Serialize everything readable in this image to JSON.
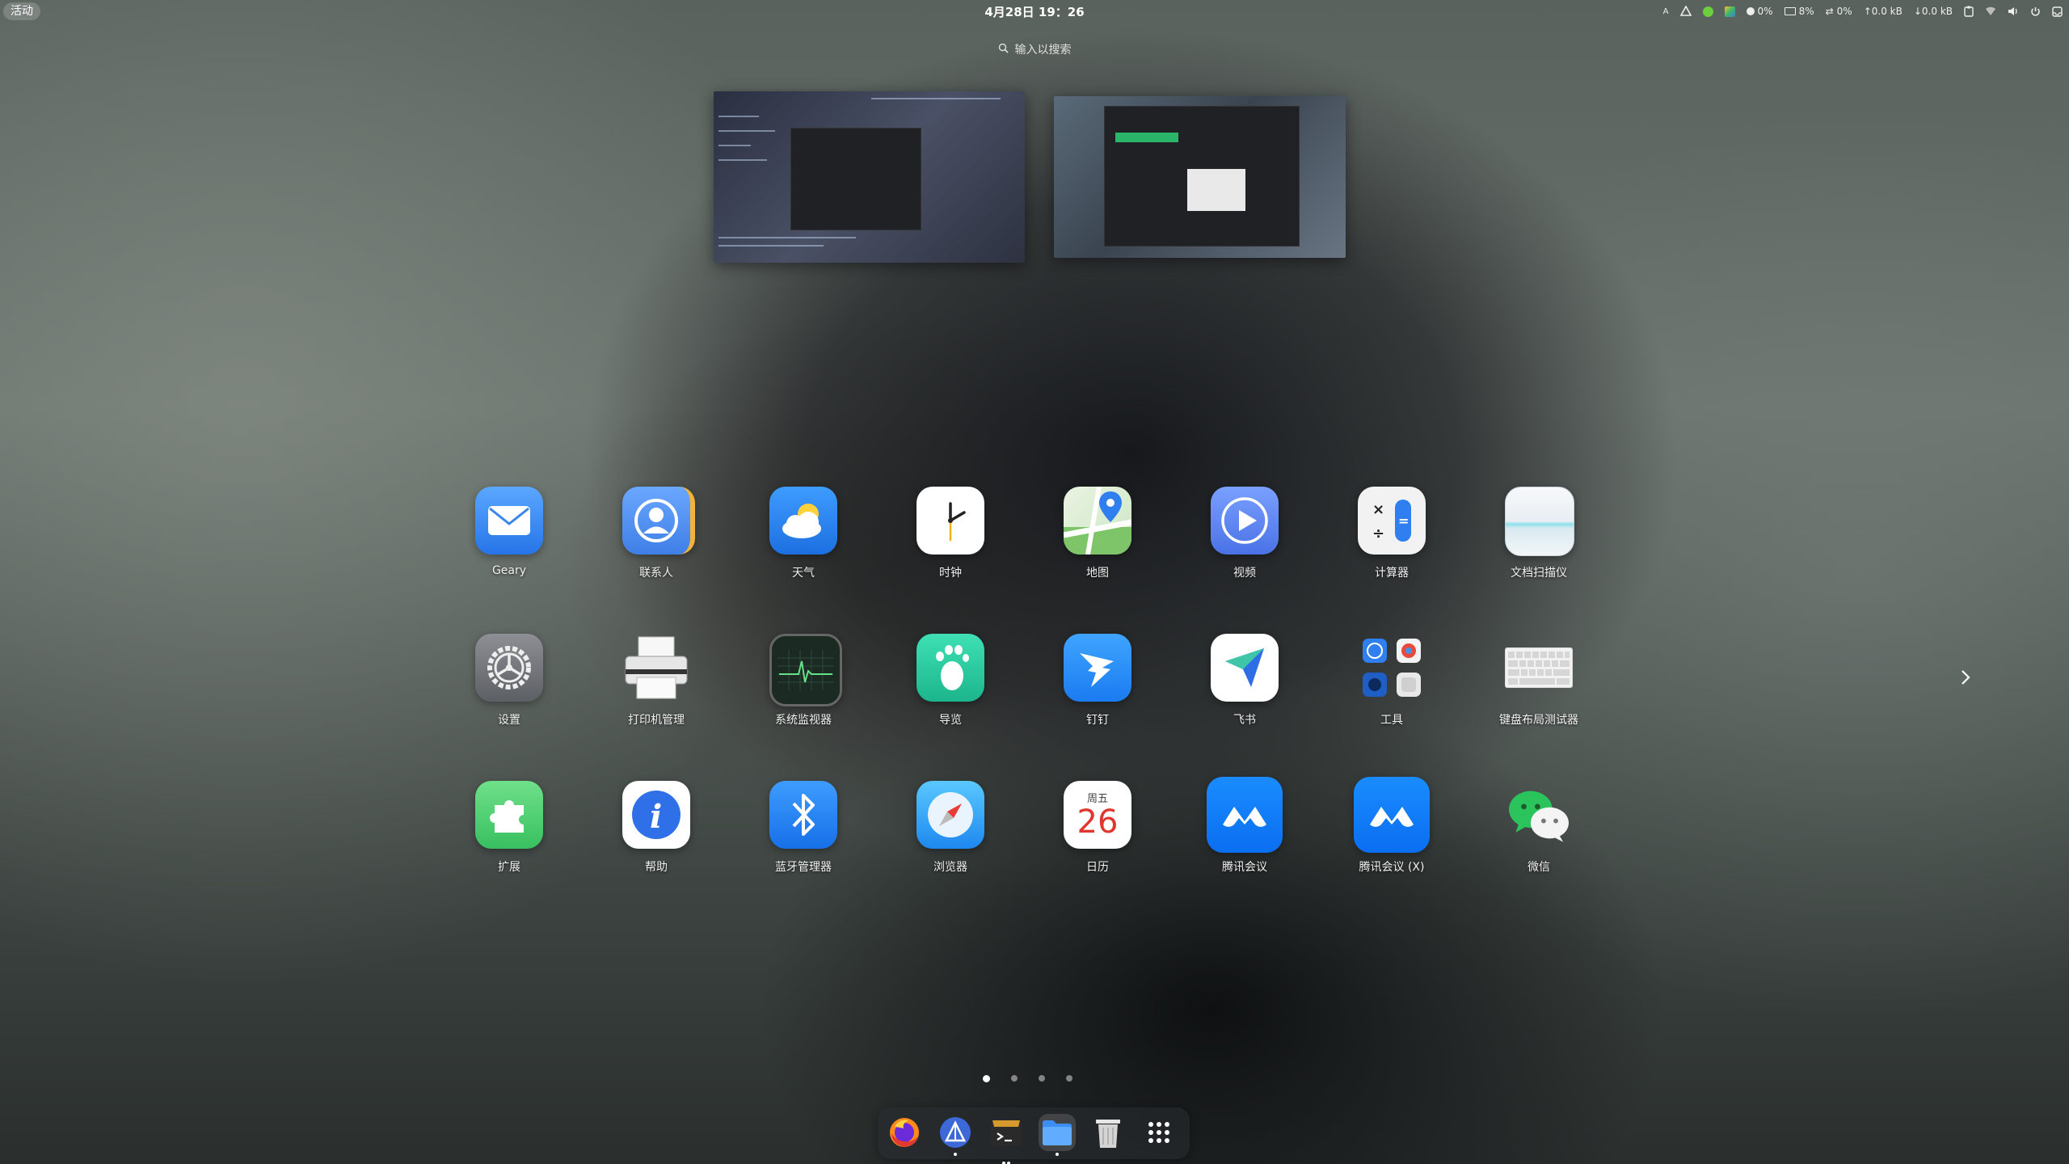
{
  "topbar": {
    "activities_label": "活动",
    "clock": "4月28日 19：26",
    "tray": {
      "input_method": "A",
      "cpu_usage": "0%",
      "mem_usage": "8%",
      "swap_usage": "0%",
      "upload": "↑0.0 kB",
      "download": "↓0.0 kB"
    }
  },
  "search": {
    "placeholder": "输入以搜索"
  },
  "apps": [
    {
      "label": "Geary",
      "icon": "mail-icon"
    },
    {
      "label": "联系人",
      "icon": "contacts-icon"
    },
    {
      "label": "天气",
      "icon": "weather-icon"
    },
    {
      "label": "时钟",
      "icon": "clock-icon"
    },
    {
      "label": "地图",
      "icon": "maps-icon"
    },
    {
      "label": "视频",
      "icon": "video-icon"
    },
    {
      "label": "计算器",
      "icon": "calculator-icon"
    },
    {
      "label": "文档扫描仪",
      "icon": "scanner-icon"
    },
    {
      "label": "设置",
      "icon": "settings-gear-icon"
    },
    {
      "label": "打印机管理",
      "icon": "printer-icon"
    },
    {
      "label": "系统监视器",
      "icon": "system-monitor-icon"
    },
    {
      "label": "导览",
      "icon": "footprint-icon"
    },
    {
      "label": "钉钉",
      "icon": "dingtalk-icon"
    },
    {
      "label": "飞书",
      "icon": "feishu-icon"
    },
    {
      "label": "工具",
      "icon": "tools-folder-icon"
    },
    {
      "label": "键盘布局测试器",
      "icon": "keyboard-icon"
    },
    {
      "label": "扩展",
      "icon": "puzzle-icon"
    },
    {
      "label": "帮助",
      "icon": "help-icon"
    },
    {
      "label": "蓝牙管理器",
      "icon": "bluetooth-icon"
    },
    {
      "label": "浏览器",
      "icon": "compass-icon"
    },
    {
      "label": "日历",
      "icon": "calendar-icon",
      "weekday": "周五",
      "day": "26"
    },
    {
      "label": "腾讯会议",
      "icon": "tencent-meeting-icon"
    },
    {
      "label": "腾讯会议 (X)",
      "icon": "tencent-meeting-x-icon"
    },
    {
      "label": "微信",
      "icon": "wechat-icon"
    }
  ],
  "pager": {
    "pages": 4,
    "current": 1
  },
  "dock": [
    {
      "name": "firefox-icon",
      "running": false
    },
    {
      "name": "app-icon",
      "running": true
    },
    {
      "name": "terminal-icon",
      "running": true
    },
    {
      "name": "files-icon",
      "running": true
    },
    {
      "name": "trash-icon",
      "running": false
    },
    {
      "name": "app-grid-icon",
      "running": false
    }
  ],
  "colors": {
    "accent": "#3a8ef6",
    "label": "#f0f0f0"
  }
}
